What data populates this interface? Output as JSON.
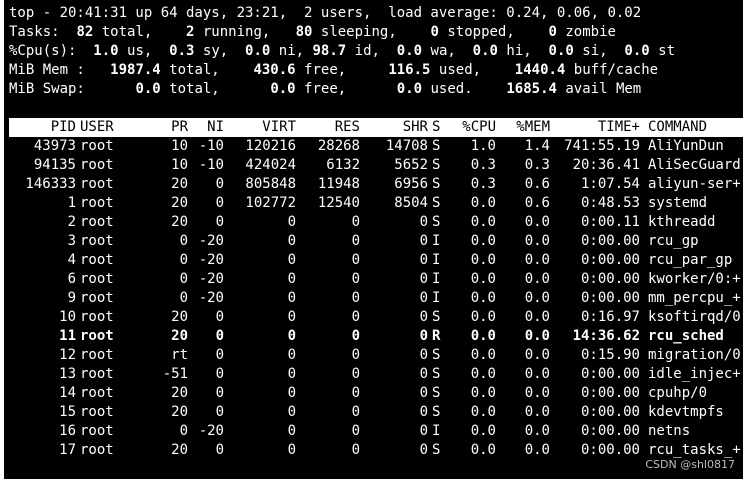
{
  "summary": {
    "line1": "top - 20:41:31 up 64 days, 23:21,  2 users,  load average: 0.24, 0.06, 0.02",
    "tasks": {
      "label": "Tasks:",
      "total": "82",
      "running": "2",
      "sleeping": "80",
      "stopped": "0",
      "zombie": "0"
    },
    "cpu": {
      "label": "%Cpu(s):",
      "us": "1.0",
      "sy": "0.3",
      "ni": "0.0",
      "id": "98.7",
      "wa": "0.0",
      "hi": "0.0",
      "si": "0.0",
      "st": "0.0"
    },
    "mem": {
      "label": "MiB Mem :",
      "total": "1987.4",
      "free": "430.6",
      "used": "116.5",
      "buff_cache": "1440.4"
    },
    "swap": {
      "label": "MiB Swap:",
      "total": "0.0",
      "free": "0.0",
      "used": "0.0",
      "avail": "1685.4"
    }
  },
  "columns": [
    "PID",
    "USER",
    "PR",
    "NI",
    "VIRT",
    "RES",
    "SHR",
    "S",
    "%CPU",
    "%MEM",
    "TIME+",
    "COMMAND"
  ],
  "processes": [
    {
      "pid": "43973",
      "user": "root",
      "pr": "10",
      "ni": "-10",
      "virt": "120216",
      "res": "28268",
      "shr": "14708",
      "s": "S",
      "cpu": "1.0",
      "mem": "1.4",
      "time": "741:55.19",
      "cmd": "AliYunDun",
      "bold": false
    },
    {
      "pid": "94135",
      "user": "root",
      "pr": "10",
      "ni": "-10",
      "virt": "424024",
      "res": "6132",
      "shr": "5652",
      "s": "S",
      "cpu": "0.3",
      "mem": "0.3",
      "time": "20:36.41",
      "cmd": "AliSecGuard",
      "bold": false
    },
    {
      "pid": "146333",
      "user": "root",
      "pr": "20",
      "ni": "0",
      "virt": "805848",
      "res": "11948",
      "shr": "6956",
      "s": "S",
      "cpu": "0.3",
      "mem": "0.6",
      "time": "1:07.54",
      "cmd": "aliyun-ser+",
      "bold": false
    },
    {
      "pid": "1",
      "user": "root",
      "pr": "20",
      "ni": "0",
      "virt": "102772",
      "res": "12540",
      "shr": "8504",
      "s": "S",
      "cpu": "0.0",
      "mem": "0.6",
      "time": "0:48.53",
      "cmd": "systemd",
      "bold": false
    },
    {
      "pid": "2",
      "user": "root",
      "pr": "20",
      "ni": "0",
      "virt": "0",
      "res": "0",
      "shr": "0",
      "s": "S",
      "cpu": "0.0",
      "mem": "0.0",
      "time": "0:00.11",
      "cmd": "kthreadd",
      "bold": false
    },
    {
      "pid": "3",
      "user": "root",
      "pr": "0",
      "ni": "-20",
      "virt": "0",
      "res": "0",
      "shr": "0",
      "s": "I",
      "cpu": "0.0",
      "mem": "0.0",
      "time": "0:00.00",
      "cmd": "rcu_gp",
      "bold": false
    },
    {
      "pid": "4",
      "user": "root",
      "pr": "0",
      "ni": "-20",
      "virt": "0",
      "res": "0",
      "shr": "0",
      "s": "I",
      "cpu": "0.0",
      "mem": "0.0",
      "time": "0:00.00",
      "cmd": "rcu_par_gp",
      "bold": false
    },
    {
      "pid": "6",
      "user": "root",
      "pr": "0",
      "ni": "-20",
      "virt": "0",
      "res": "0",
      "shr": "0",
      "s": "I",
      "cpu": "0.0",
      "mem": "0.0",
      "time": "0:00.00",
      "cmd": "kworker/0:+",
      "bold": false
    },
    {
      "pid": "9",
      "user": "root",
      "pr": "0",
      "ni": "-20",
      "virt": "0",
      "res": "0",
      "shr": "0",
      "s": "I",
      "cpu": "0.0",
      "mem": "0.0",
      "time": "0:00.00",
      "cmd": "mm_percpu_+",
      "bold": false
    },
    {
      "pid": "10",
      "user": "root",
      "pr": "20",
      "ni": "0",
      "virt": "0",
      "res": "0",
      "shr": "0",
      "s": "S",
      "cpu": "0.0",
      "mem": "0.0",
      "time": "0:16.97",
      "cmd": "ksoftirqd/0",
      "bold": false
    },
    {
      "pid": "11",
      "user": "root",
      "pr": "20",
      "ni": "0",
      "virt": "0",
      "res": "0",
      "shr": "0",
      "s": "R",
      "cpu": "0.0",
      "mem": "0.0",
      "time": "14:36.62",
      "cmd": "rcu_sched",
      "bold": true
    },
    {
      "pid": "12",
      "user": "root",
      "pr": "rt",
      "ni": "0",
      "virt": "0",
      "res": "0",
      "shr": "0",
      "s": "S",
      "cpu": "0.0",
      "mem": "0.0",
      "time": "0:15.90",
      "cmd": "migration/0",
      "bold": false
    },
    {
      "pid": "13",
      "user": "root",
      "pr": "-51",
      "ni": "0",
      "virt": "0",
      "res": "0",
      "shr": "0",
      "s": "S",
      "cpu": "0.0",
      "mem": "0.0",
      "time": "0:00.00",
      "cmd": "idle_injec+",
      "bold": false
    },
    {
      "pid": "14",
      "user": "root",
      "pr": "20",
      "ni": "0",
      "virt": "0",
      "res": "0",
      "shr": "0",
      "s": "S",
      "cpu": "0.0",
      "mem": "0.0",
      "time": "0:00.00",
      "cmd": "cpuhp/0",
      "bold": false
    },
    {
      "pid": "15",
      "user": "root",
      "pr": "20",
      "ni": "0",
      "virt": "0",
      "res": "0",
      "shr": "0",
      "s": "S",
      "cpu": "0.0",
      "mem": "0.0",
      "time": "0:00.00",
      "cmd": "kdevtmpfs",
      "bold": false
    },
    {
      "pid": "16",
      "user": "root",
      "pr": "0",
      "ni": "-20",
      "virt": "0",
      "res": "0",
      "shr": "0",
      "s": "I",
      "cpu": "0.0",
      "mem": "0.0",
      "time": "0:00.00",
      "cmd": "netns",
      "bold": false
    },
    {
      "pid": "17",
      "user": "root",
      "pr": "20",
      "ni": "0",
      "virt": "0",
      "res": "0",
      "shr": "0",
      "s": "S",
      "cpu": "0.0",
      "mem": "0.0",
      "time": "0:00.00",
      "cmd": "rcu_tasks_+",
      "bold": false
    }
  ],
  "watermark": "CSDN @shl0817"
}
